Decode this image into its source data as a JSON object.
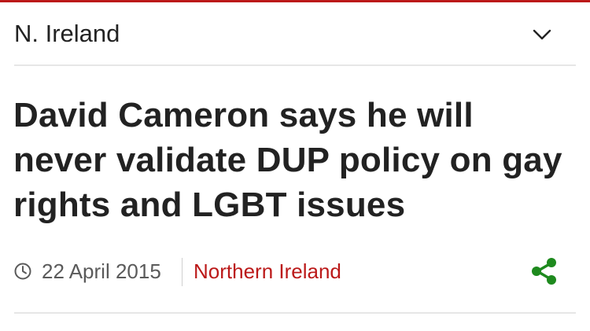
{
  "header": {
    "section_title": "N. Ireland",
    "accent_color": "#bb1919"
  },
  "article": {
    "headline": "David Cameron says he will never validate DUP policy on gay rights and LGBT issues",
    "date": "22 April 2015",
    "category": "Northern Ireland",
    "category_color": "#bb1919",
    "share_color": "#1e8a1e"
  },
  "icons": {
    "menu_toggle": "chevron-down-icon",
    "timestamp": "clock-icon",
    "share": "share-icon"
  }
}
